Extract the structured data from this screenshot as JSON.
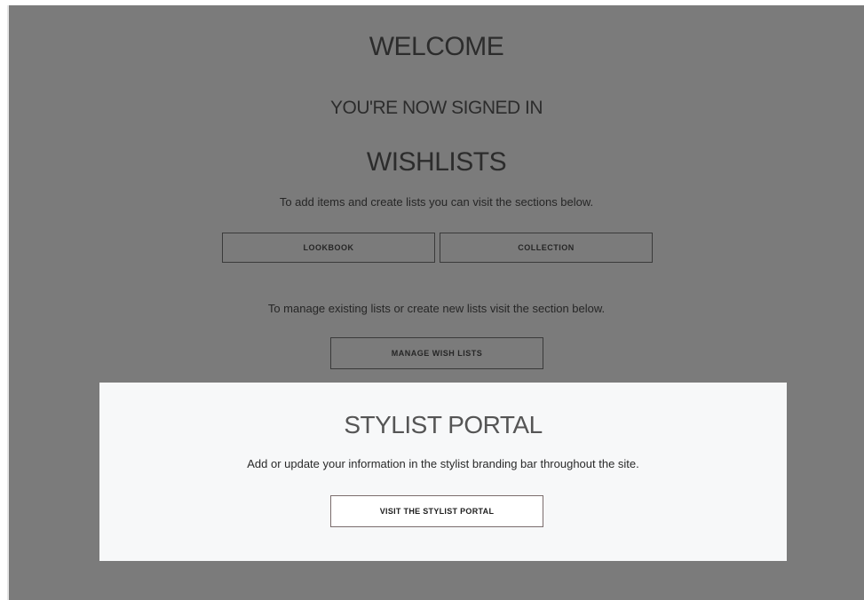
{
  "welcome": {
    "title": "WELCOME",
    "subtitle": "YOU'RE NOW SIGNED IN"
  },
  "wishlists": {
    "title": "WISHLISTS",
    "add_text": "To add items and create lists you can visit the sections below.",
    "lookbook_label": "LOOKBOOK",
    "collection_label": "COLLECTION",
    "manage_text": "To manage existing lists or create new lists visit the section below.",
    "manage_label": "MANAGE WISH LISTS"
  },
  "stylist_portal": {
    "title": "STYLIST PORTAL",
    "description": "Add or update your information in the stylist branding bar throughout the site.",
    "button_label": "VISIT THE STYLIST PORTAL"
  },
  "colors": {
    "overlay": "#7b7b7b",
    "portal_background": "#f7f8f9",
    "text_dark": "#262626"
  }
}
